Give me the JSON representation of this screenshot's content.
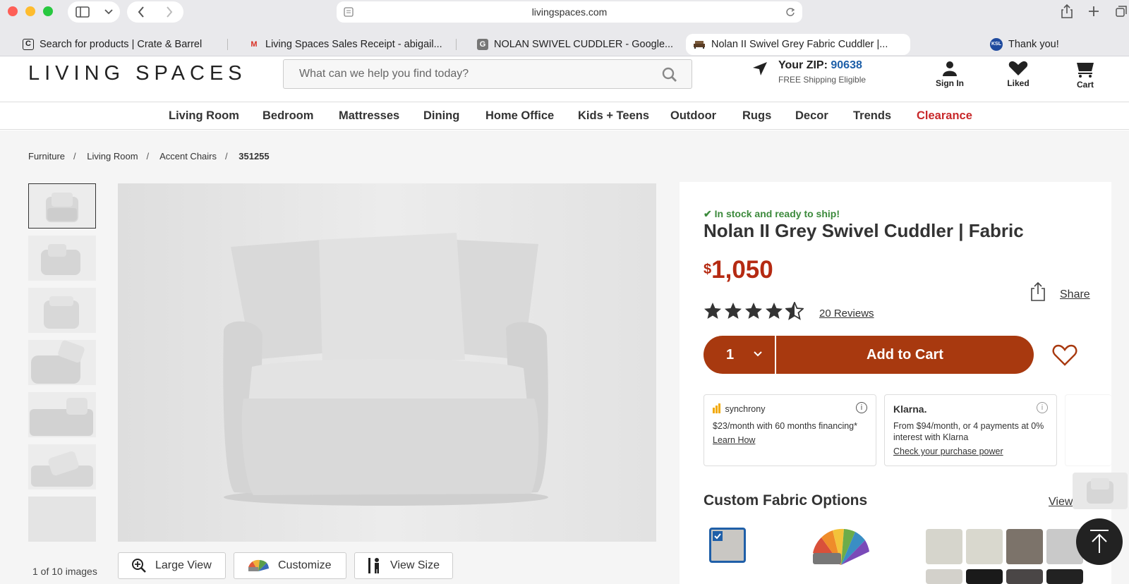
{
  "browser": {
    "url": "livingspaces.com",
    "tabs": [
      {
        "label": "Search for products | Crate & Barrel",
        "favicon": "C"
      },
      {
        "label": "Living Spaces Sales Receipt - abigail...",
        "favicon": "M"
      },
      {
        "label": "NOLAN SWIVEL CUDDLER - Google...",
        "favicon": "G"
      },
      {
        "label": "Nolan II Swivel Grey Fabric Cuddler |...",
        "favicon": "sofa-icon"
      },
      {
        "label": "Thank you!",
        "favicon": "KSL"
      }
    ]
  },
  "header": {
    "logo": "LIVING SPACES",
    "search_placeholder": "What can we help you find today?",
    "zip_label": "Your ZIP:",
    "zip_value": "90638",
    "shipping": "FREE Shipping Eligible",
    "sign_in": "Sign In",
    "liked": "Liked",
    "cart": "Cart"
  },
  "nav": [
    "Living Room",
    "Bedroom",
    "Mattresses",
    "Dining",
    "Home Office",
    "Kids + Teens",
    "Outdoor",
    "Rugs",
    "Decor",
    "Trends",
    "Clearance"
  ],
  "breadcrumb": [
    "Furniture",
    "Living Room",
    "Accent Chairs",
    "351255"
  ],
  "gallery": {
    "counter": "1 of 10 images",
    "large_view": "Large View",
    "customize": "Customize",
    "view_size": "View Size"
  },
  "product": {
    "stock": "In stock and ready to ship!",
    "title": "Nolan II Grey Swivel Cuddler | Fabric",
    "currency": "$",
    "price": "1,050",
    "rating": 4.5,
    "reviews": "20 Reviews",
    "share": "Share",
    "quantity": "1",
    "add_to_cart": "Add to Cart"
  },
  "financing": [
    {
      "brand": "synchrony",
      "text": "$23/month with 60 months financing*",
      "link": "Learn How"
    },
    {
      "brand": "Klarna.",
      "text": "From $94/month, or 4 payments at 0% interest with Klarna",
      "link": "Check your purchase power"
    }
  ],
  "fabric": {
    "heading": "Custom Fabric Options",
    "view_all": "View All"
  },
  "colors": {
    "accent": "#a8390f",
    "price": "#b52a12",
    "stock": "#3c8a3c",
    "clearance": "#c8282a",
    "zip": "#1d5fa8"
  }
}
